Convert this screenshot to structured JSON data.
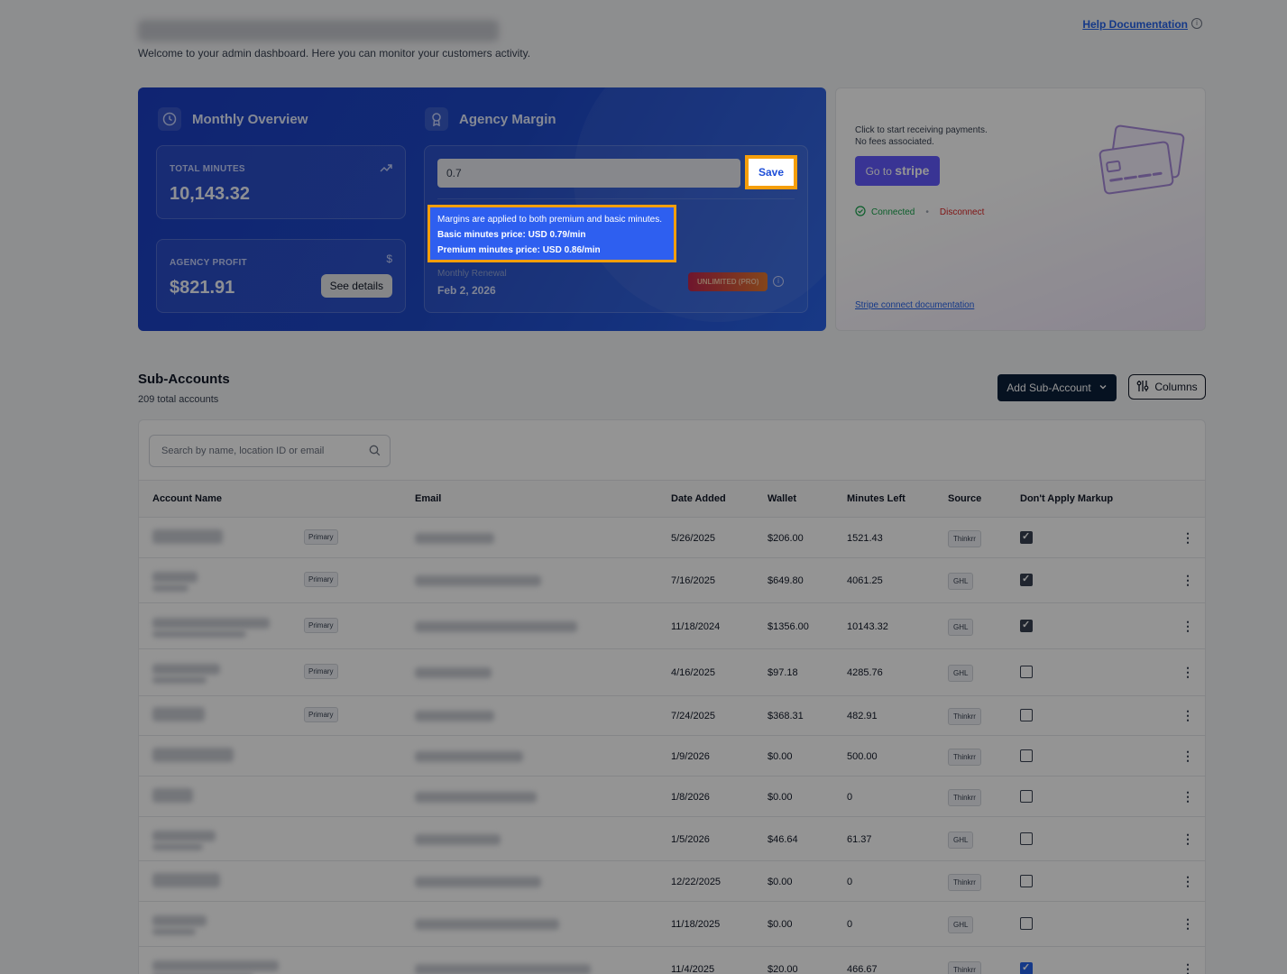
{
  "header": {
    "subtitle": "Welcome to your admin dashboard. Here you can monitor your customers activity.",
    "help_link": "Help Documentation"
  },
  "overview": {
    "title": "Monthly Overview",
    "total_minutes_label": "TOTAL MINUTES",
    "total_minutes_value": "10,143.32",
    "agency_profit_label": "AGENCY PROFIT",
    "agency_profit_value": "$821.91",
    "see_details": "See details"
  },
  "margin": {
    "title": "Agency Margin",
    "input_value": "0.7",
    "save_label": "Save",
    "info_line1": "Margins are applied to both premium and basic minutes.",
    "info_line2": "Basic minutes price: USD 0.79/min",
    "info_line3": "Premium minutes price: USD 0.86/min",
    "renewal_label": "Monthly Renewal",
    "renewal_date": "Feb 2, 2026",
    "plan_badge": "UNLIMITED (PRO)"
  },
  "stripe": {
    "line1": "Click to start receiving payments.",
    "line2": "No fees associated.",
    "button_prefix": "Go to",
    "button_brand": "stripe",
    "connected": "Connected",
    "disconnect": "Disconnect",
    "doc_link": "Stripe connect documentation"
  },
  "sub_accounts": {
    "title": "Sub-Accounts",
    "count": "209 total accounts",
    "add_button": "Add Sub-Account",
    "columns_button": "Columns",
    "search_placeholder": "Search by name, location ID or email",
    "columns": [
      "Account Name",
      "Email",
      "Date Added",
      "Wallet",
      "Minutes Left",
      "Source",
      "Don't Apply Markup"
    ],
    "rows": [
      {
        "primary": "Primary",
        "date": "5/26/2025",
        "wallet": "$206.00",
        "minutes": "1521.43",
        "source": "Thinkrr",
        "checked": true
      },
      {
        "primary": "Primary",
        "date": "7/16/2025",
        "wallet": "$649.80",
        "minutes": "4061.25",
        "source": "GHL",
        "checked": true
      },
      {
        "primary": "Primary",
        "date": "11/18/2024",
        "wallet": "$1356.00",
        "minutes": "10143.32",
        "source": "GHL",
        "checked": true
      },
      {
        "primary": "Primary",
        "date": "4/16/2025",
        "wallet": "$97.18",
        "minutes": "4285.76",
        "source": "GHL",
        "checked": false
      },
      {
        "primary": "Primary",
        "date": "7/24/2025",
        "wallet": "$368.31",
        "minutes": "482.91",
        "source": "Thinkrr",
        "checked": false
      },
      {
        "primary": "",
        "date": "1/9/2026",
        "wallet": "$0.00",
        "minutes": "500.00",
        "source": "Thinkrr",
        "checked": false
      },
      {
        "primary": "",
        "date": "1/8/2026",
        "wallet": "$0.00",
        "minutes": "0",
        "source": "Thinkrr",
        "checked": false
      },
      {
        "primary": "",
        "date": "1/5/2026",
        "wallet": "$46.64",
        "minutes": "61.37",
        "source": "GHL",
        "checked": false
      },
      {
        "primary": "",
        "date": "12/22/2025",
        "wallet": "$0.00",
        "minutes": "0",
        "source": "Thinkrr",
        "checked": false
      },
      {
        "primary": "",
        "date": "11/18/2025",
        "wallet": "$0.00",
        "minutes": "0",
        "source": "GHL",
        "checked": false
      },
      {
        "primary": "",
        "date": "11/4/2025",
        "wallet": "$20.00",
        "minutes": "466.67",
        "source": "Thinkrr",
        "checked": true
      }
    ]
  }
}
